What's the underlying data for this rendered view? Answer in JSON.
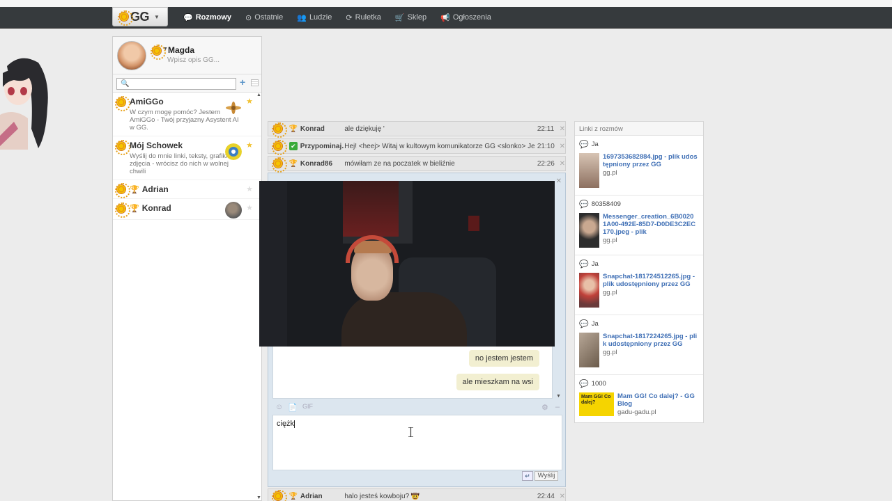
{
  "nav": {
    "logo": "GG",
    "items": [
      {
        "label": "Rozmowy",
        "icon": "chat-bubble-icon",
        "active": true
      },
      {
        "label": "Ostatnie",
        "icon": "clock-icon",
        "active": false
      },
      {
        "label": "Ludzie",
        "icon": "people-icon",
        "active": false
      },
      {
        "label": "Ruletka",
        "icon": "roulette-icon",
        "active": false
      },
      {
        "label": "Sklep",
        "icon": "cart-icon",
        "active": false
      },
      {
        "label": "Ogłoszenia",
        "icon": "megaphone-icon",
        "active": false
      }
    ]
  },
  "profile": {
    "name": "Magda",
    "description_placeholder": "Wpisz opis GG..."
  },
  "contacts": [
    {
      "name": "AmiGGo",
      "description": "W czym mogę pomóc? Jestem AmiGGo - Twój przyjazny Asystent AI w GG.",
      "starred": true
    },
    {
      "name": "Mój Schowek",
      "description": "Wyślij do mnie linki, teksty, grafiki i zdjęcia - wrócisz do nich w wolnej chwili",
      "starred": true
    },
    {
      "name": "Adrian",
      "description": "",
      "starred": false
    },
    {
      "name": "Konrad",
      "description": "",
      "starred": false
    }
  ],
  "tabs_top": [
    {
      "name": "Konrad",
      "message": "ale dziękuję '",
      "time": "22:11",
      "icon": "trophy"
    },
    {
      "name": "Przypominaj...",
      "message": "Hej! <heej> Witaj w kultowym komunikatorze GG <slonko> Jeste",
      "time": "21:10",
      "icon": "check"
    },
    {
      "name": "Konrad86",
      "message": "mówiłam ze na poczatek w bieliźnie",
      "time": "22:26",
      "icon": "trophy"
    }
  ],
  "tab_bottom": {
    "name": "Adrian",
    "message": "halo jesteś kowboju? 🤠",
    "time": "22:44",
    "icon": "trophy"
  },
  "chat": {
    "messages": [
      {
        "text": "no jestem jestem"
      },
      {
        "text": "ale mieszkam na wsi"
      }
    ],
    "toolbar_gif": "GIF",
    "input_value": "ciężk",
    "send_label": "Wyślij"
  },
  "links": {
    "header": "Linki z rozmów",
    "groups": [
      {
        "sender": "Ja",
        "title": "1697353682884.jpg - plik udostępniony przez GG",
        "domain": "gg.pl",
        "thumb_color": "#b69a8a"
      },
      {
        "sender": "80358409",
        "title": "Messenger_creation_6B0020 1A00-492E-85D7-D0DE3C2EC170.jpeg - plik",
        "domain": "gg.pl",
        "thumb_color": "#3a3a3a"
      },
      {
        "sender": "Ja",
        "title": "Snapchat-181724512265.jpg - plik udostępniony przez GG",
        "domain": "gg.pl",
        "thumb_color": "#c0413a"
      },
      {
        "sender": "Ja",
        "title": "Snapchat-1817224265.jpg - plik udostępniony przez GG",
        "domain": "gg.pl",
        "thumb_color": "#8b7a6a"
      },
      {
        "sender": "1000",
        "title": "Mam GG! Co dalej? - GG Blog",
        "domain": "gadu-gadu.pl",
        "thumb_text": "Mam GG! Co dalej?"
      }
    ]
  },
  "colors": {
    "accent": "#f0c030",
    "link": "#3f6fb5",
    "navbar": "#363a3d"
  }
}
